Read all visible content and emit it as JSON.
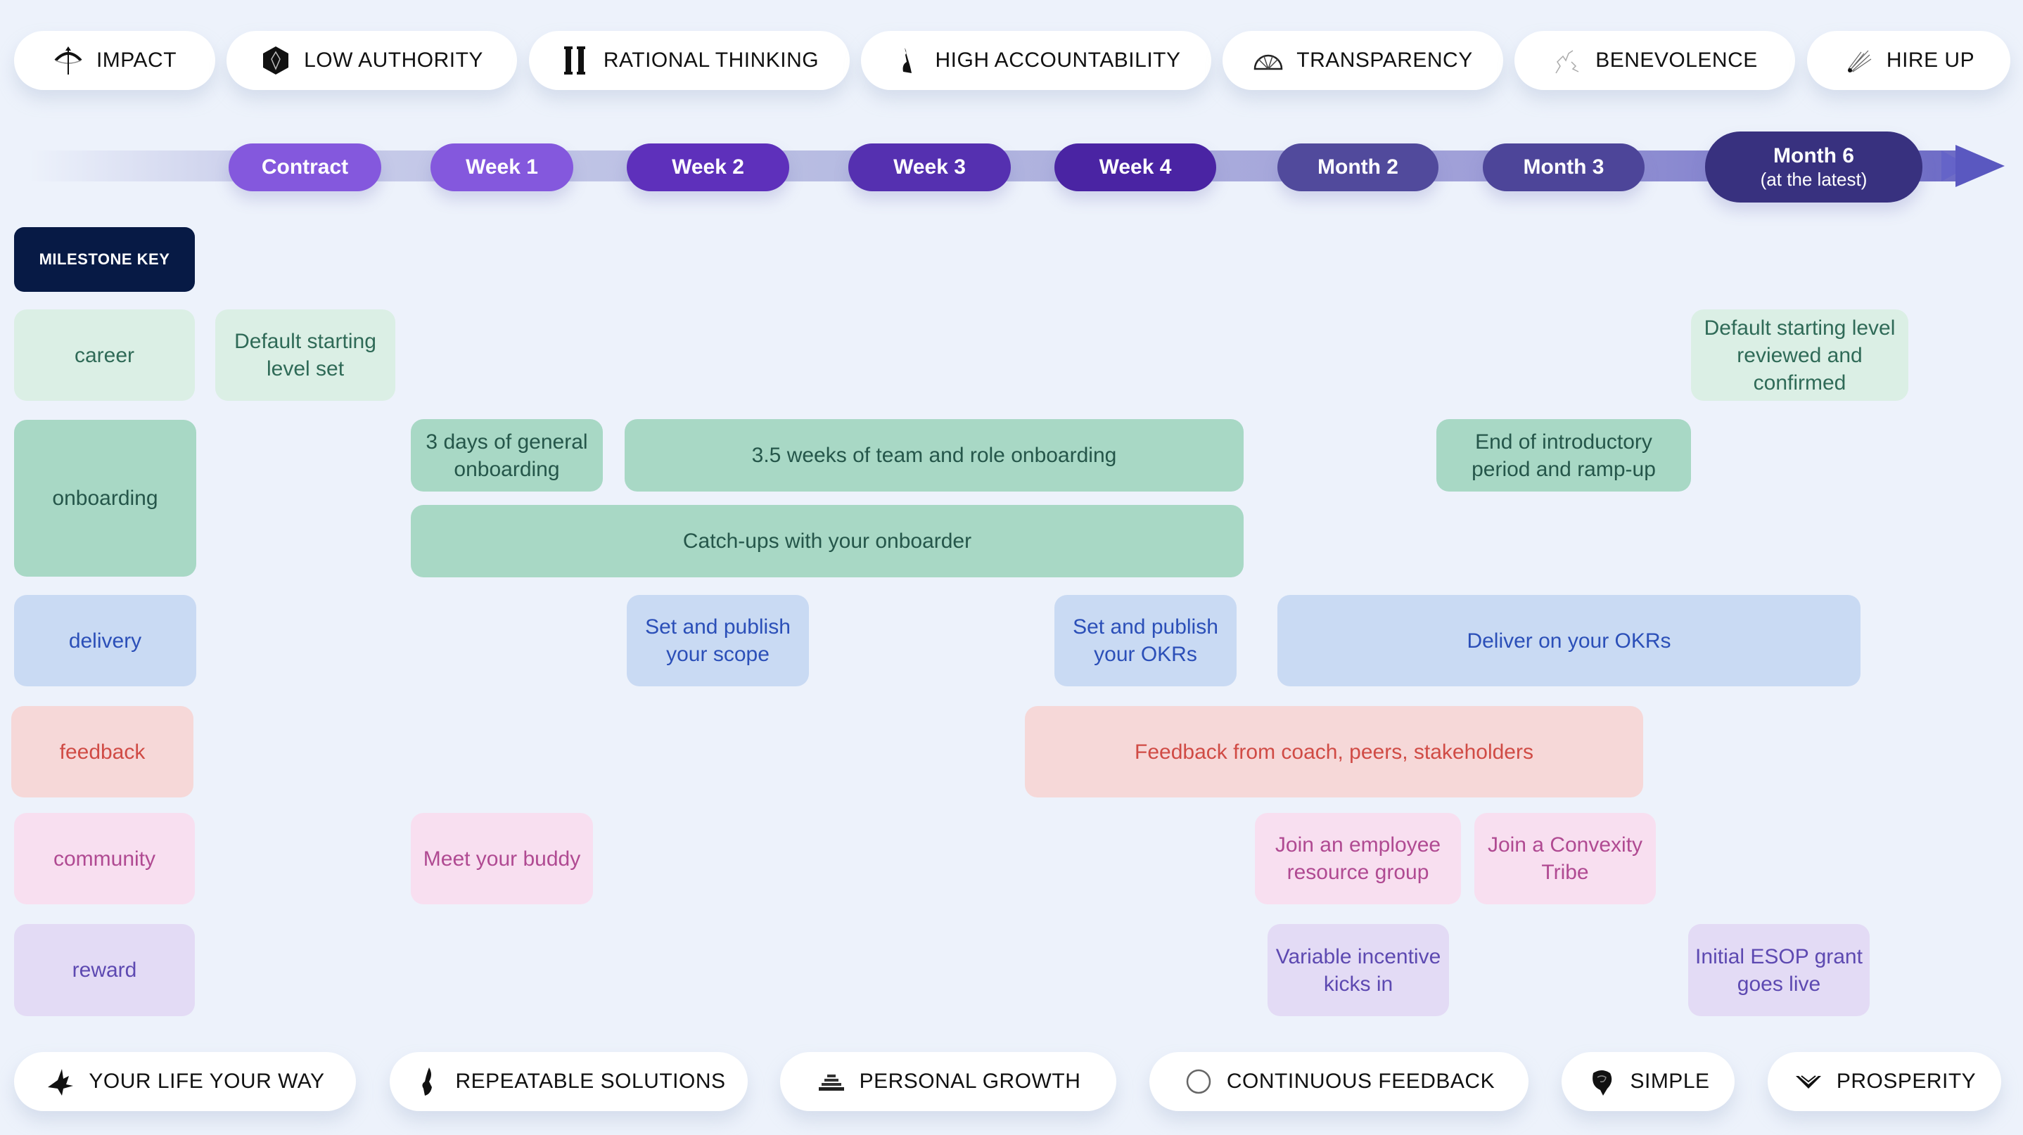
{
  "values_top": [
    {
      "label": "IMPACT",
      "icon": "bow-arrow-icon"
    },
    {
      "label": "LOW AUTHORITY",
      "icon": "hexagon-leaf-icon"
    },
    {
      "label": "RATIONAL THINKING",
      "icon": "pillars-icon"
    },
    {
      "label": "HIGH ACCOUNTABILITY",
      "icon": "torch-hand-icon"
    },
    {
      "label": "TRANSPARENCY",
      "icon": "fan-window-icon"
    },
    {
      "label": "BENEVOLENCE",
      "icon": "cracked-line-icon"
    },
    {
      "label": "HIRE UP",
      "icon": "feather-burst-icon"
    }
  ],
  "timeline": {
    "milestones": [
      {
        "label": "Contract",
        "color": "#8458dd"
      },
      {
        "label": "Week 1",
        "color": "#8458dd"
      },
      {
        "label": "Week 2",
        "color": "#5e30bb"
      },
      {
        "label": "Week 3",
        "color": "#5530b0"
      },
      {
        "label": "Week 4",
        "color": "#4a24a3"
      },
      {
        "label": "Month 2",
        "color": "#514a9c"
      },
      {
        "label": "Month 3",
        "color": "#4d4599"
      },
      {
        "label": "Month 6",
        "sublabel": "(at the latest)",
        "color": "#38317f"
      }
    ]
  },
  "milestone_key": {
    "label": "MILESTONE KEY"
  },
  "categories": {
    "career": "career",
    "onboarding": "onboarding",
    "delivery": "delivery",
    "feedback": "feedback",
    "community": "community",
    "reward": "reward"
  },
  "items": {
    "career_start": "Default starting level set",
    "career_review": "Default starting level reviewed and confirmed",
    "onb_general": "3 days of general onboarding",
    "onb_team": "3.5 weeks of team and role onboarding",
    "onb_catchups": "Catch-ups with your onboarder",
    "onb_end": "End of introductory period and ramp-up",
    "deliv_scope": "Set and publish your scope",
    "deliv_okrs": "Set and publish your OKRs",
    "deliv_deliver": "Deliver on your OKRs",
    "fb_coach": "Feedback from coach, peers, stakeholders",
    "comm_buddy": "Meet your buddy",
    "comm_erg": "Join an employee resource group",
    "comm_tribe": "Join a Convexity Tribe",
    "rew_variable": "Variable incentive kicks in",
    "rew_esop": "Initial ESOP grant goes live"
  },
  "values_bottom": [
    {
      "label": "YOUR LIFE YOUR WAY",
      "icon": "bird-wing-icon"
    },
    {
      "label": "REPEATABLE SOLUTIONS",
      "icon": "hand-feather-icon"
    },
    {
      "label": "PERSONAL GROWTH",
      "icon": "stacked-steps-icon"
    },
    {
      "label": "CONTINUOUS FEEDBACK",
      "icon": "ring-icon"
    },
    {
      "label": "SIMPLE",
      "icon": "rose-icon"
    },
    {
      "label": "PROSPERITY",
      "icon": "chevron-down-double-icon"
    }
  ]
}
